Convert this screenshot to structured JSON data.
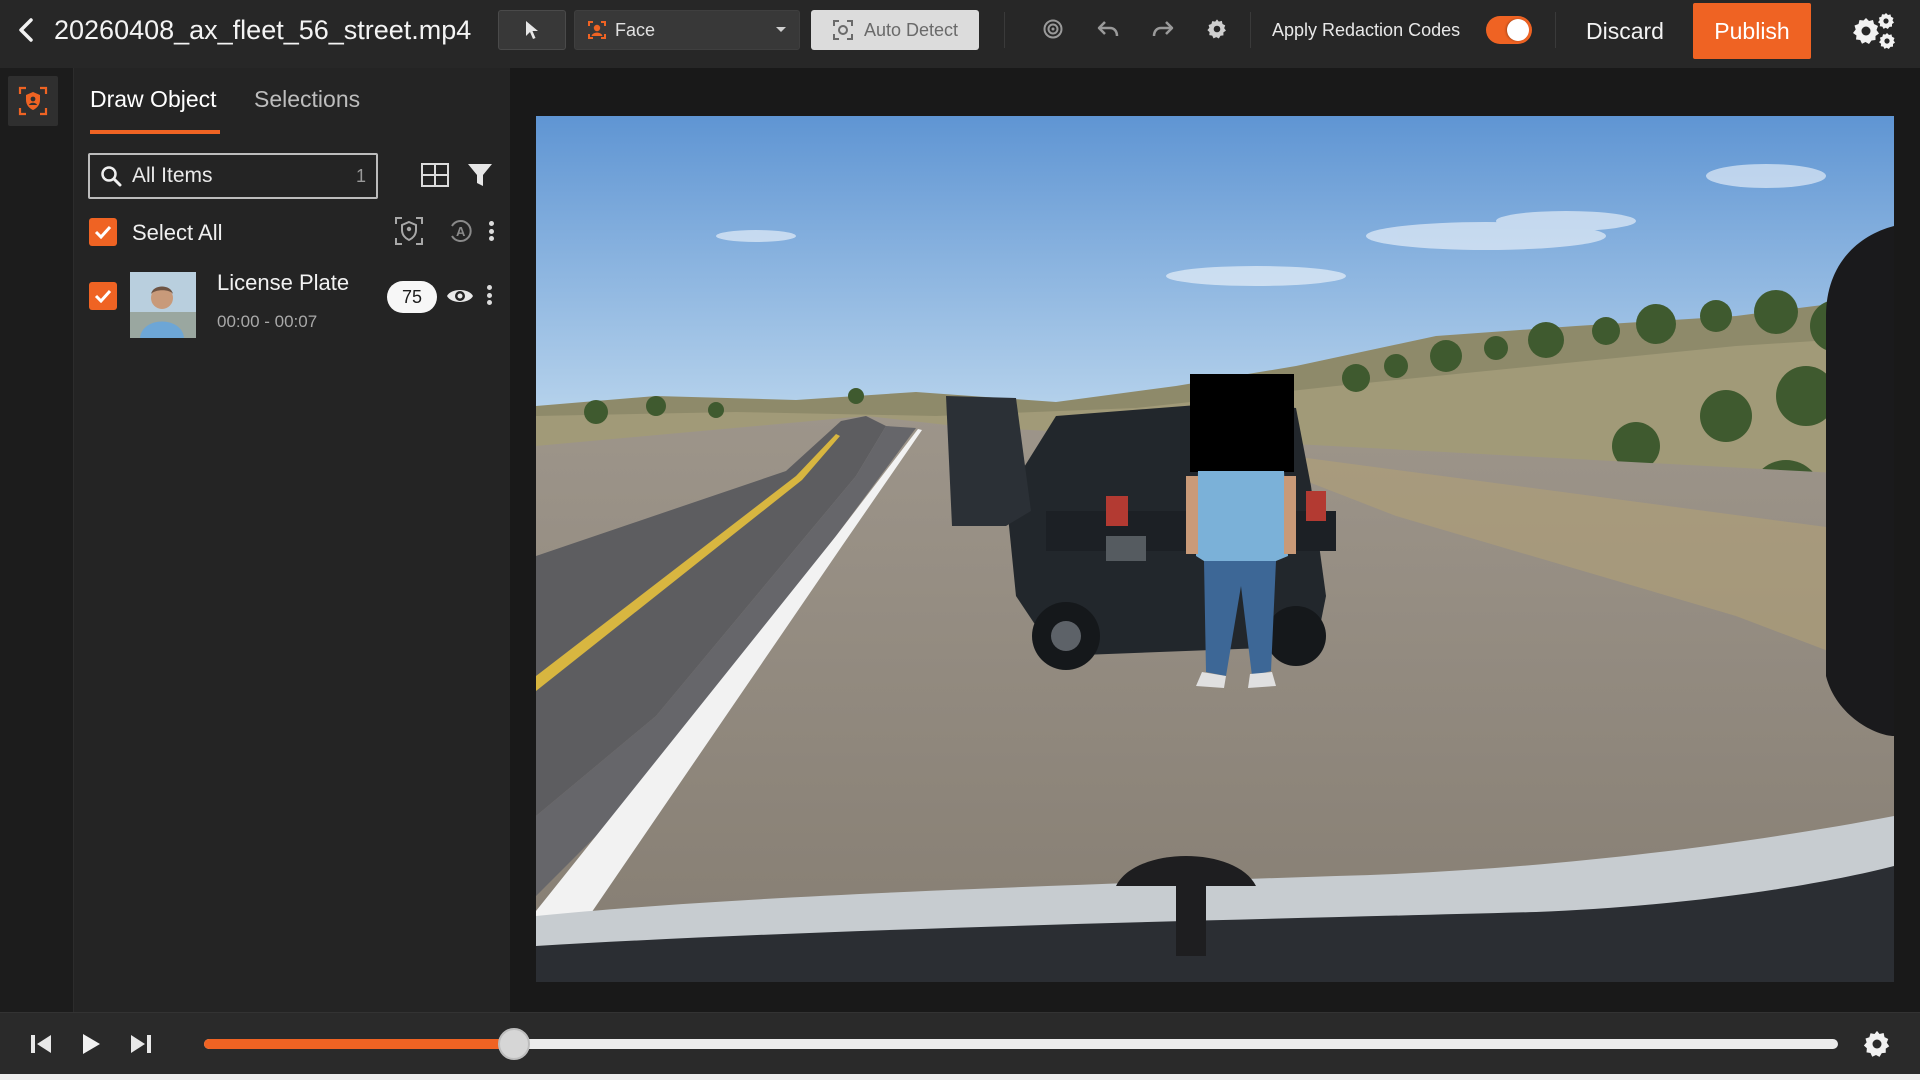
{
  "header": {
    "file_name": "20260408_ax_fleet_56_street.mp4",
    "detection_type": "Face",
    "auto_detect_label": "Auto Detect",
    "apply_redaction_label": "Apply Redaction Codes",
    "apply_redaction_on": true,
    "discard_label": "Discard",
    "publish_label": "Publish"
  },
  "panel": {
    "tabs": [
      {
        "label": "Draw Object",
        "active": true
      },
      {
        "label": "Selections",
        "active": false
      }
    ],
    "search": {
      "placeholder": "All Items",
      "count": "1"
    },
    "select_all_label": "Select All",
    "items": [
      {
        "name": "License Plate",
        "time_range": "00:00 - 00:07",
        "confidence": "75",
        "checked": true
      }
    ]
  },
  "player": {
    "progress": 0.19
  },
  "colors": {
    "accent": "#ef6323",
    "background": "#202020",
    "panel": "#242424"
  },
  "icons": [
    "chevron-left-icon",
    "pointer-icon",
    "face-icon",
    "dropdown-caret-icon",
    "auto-detect-icon",
    "target-icon",
    "undo-icon",
    "redo-icon",
    "settings-icon",
    "settings-gears-icon",
    "redact-shield-icon",
    "search-icon",
    "grid-view-icon",
    "filter-icon",
    "checkmark-icon",
    "shield-redact-icon",
    "auto-label-icon",
    "more-vertical-icon",
    "eye-icon",
    "skip-back-icon",
    "play-icon",
    "skip-forward-icon"
  ]
}
